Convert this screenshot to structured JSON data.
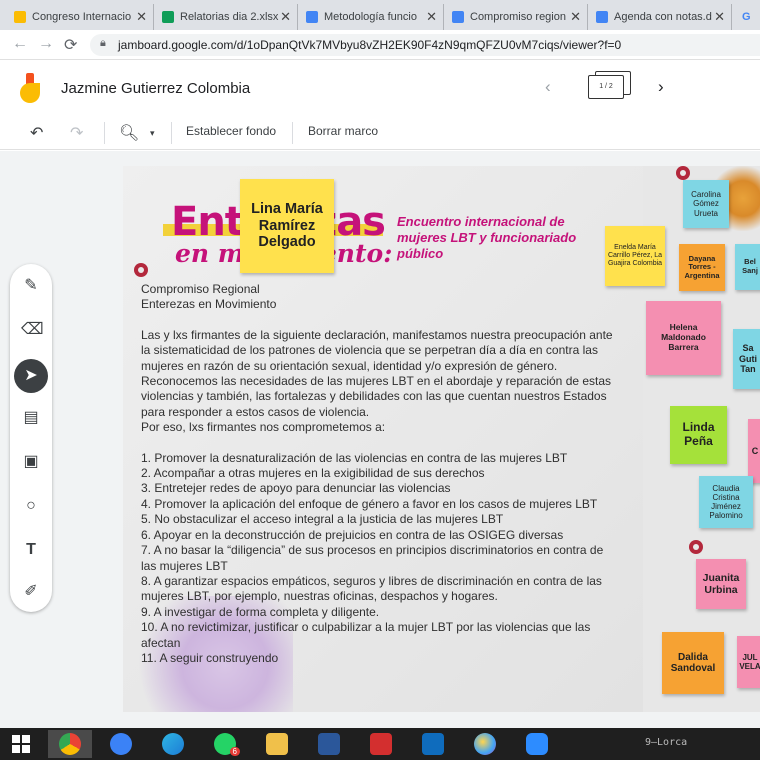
{
  "browser": {
    "tabs": [
      {
        "label": "Congreso Internacio",
        "color": "#fbbc04",
        "close": "✕"
      },
      {
        "label": "Relatorias dia 2.xlsx",
        "color": "#0f9d58",
        "close": "✕"
      },
      {
        "label": "Metodología funcio",
        "color": "#4285f4",
        "close": "✕"
      },
      {
        "label": "Compromiso region",
        "color": "#4285f4",
        "close": "✕"
      },
      {
        "label": "Agenda con notas.d",
        "color": "#4285f4",
        "close": "✕"
      }
    ],
    "extra_tab_glyph": "G",
    "url": "jamboard.google.com/d/1oDpanQtVk7MVbyu8vZH2EK90F4zN9qmQFZU0vM7ciqs/viewer?f=0"
  },
  "header": {
    "title": "Jazmine Gutierrez Colombia",
    "frame_counter": "1 / 2"
  },
  "toolbar": {
    "set_background": "Establecer fondo",
    "clear_frame": "Borrar marco"
  },
  "board": {
    "brand_line1": "Enterezas",
    "brand_line2": "en movimiento:",
    "encounter": "Encuentro internacional de mujeres LBT y funcionariado público",
    "heading_lines": [
      "Compromiso Regional",
      "Enterezas en Movimiento"
    ],
    "intro": "Las y lxs firmantes de la siguiente declaración, manifestamos nuestra preocupación ante la sistematicidad de los patrones de violencia que se perpetran día a día en contra las mujeres en razón de su orientación sexual, identidad y/o expresión de género. Reconocemos las necesidades de las mujeres LBT en el abordaje y reparación de estas violencias y también, las fortalezas y debilidades con las que cuentan nuestros Estados para responder a estos casos de violencia.",
    "commit_line": "Por eso, lxs firmantes nos comprometemos a:",
    "commitments": [
      "1. Promover la desnaturalización de las violencias en contra de las mujeres LBT",
      "2. Acompañar a otras mujeres en la exigibilidad de sus derechos",
      "3. Entretejer redes de apoyo para denunciar las violencias",
      "4. Promover la aplicación del enfoque de género a favor en los casos de mujeres LBT",
      "5. No obstaculizar el acceso integral a la justicia de las mujeres LBT",
      "6. Apoyar en la deconstrucción de prejuicios en contra de las OSIGEG diversas",
      "7. A no basar la “diligencia” de sus procesos en principios discriminatorios en contra de las mujeres LBT",
      "8. A garantizar espacios empáticos, seguros y libres de discriminación en contra de las mujeres LBT, por ejemplo, nuestras oficinas, despachos y hogares.",
      "9. A investigar de forma completa y diligente.",
      "10. A no revictimizar, justificar o culpabilizar a la mujer LBT por las violencias que las afectan",
      "11. A seguir construyendo"
    ],
    "sticky_notes": [
      {
        "text": "Lina María Ramírez Delgado",
        "color": "#ffe14d"
      },
      {
        "text": "Carolina Gómez Urueta",
        "color": "#7fd6e4"
      },
      {
        "text": "Enelda María Carrillo Pérez, La Guajira Colombia",
        "color": "#ffe14d"
      },
      {
        "text": "Dayana Torres - Argentina",
        "color": "#f6a233"
      },
      {
        "text": "Bel Sanj",
        "color": "#7fd6e4"
      },
      {
        "text": "Helena Maldonado Barrera",
        "color": "#f48fb1"
      },
      {
        "text": "Sa Guti Tan",
        "color": "#7fd6e4"
      },
      {
        "text": "Linda Peña",
        "color": "#a5e13a"
      },
      {
        "text": "C",
        "color": "#f48fb1"
      },
      {
        "text": "Claudia Cristina Jiménez Palomino",
        "color": "#7fd6e4"
      },
      {
        "text": "Juanita Urbina",
        "color": "#f48fb1"
      },
      {
        "text": "Dalida Sandoval",
        "color": "#f6a233"
      },
      {
        "text": "JUL VELA",
        "color": "#f48fb1"
      }
    ]
  },
  "taskbar": {
    "whatsapp_badge": "6",
    "tray_text": "9—Lorca"
  }
}
